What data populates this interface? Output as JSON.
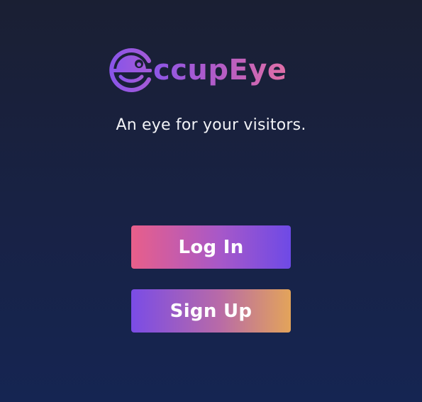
{
  "app": {
    "logo_text": "ccupEye",
    "tagline": "An eye for your visitors."
  },
  "actions": {
    "login_label": "Log In",
    "signup_label": "Sign Up"
  },
  "icons": {
    "logo": "eye-logo-icon"
  },
  "colors": {
    "background_top": "#1a1f33",
    "background_bottom": "#152552",
    "brand_purple": "#8d56e6",
    "brand_pink": "#e06fa6",
    "brand_orange": "#e3a45a"
  }
}
